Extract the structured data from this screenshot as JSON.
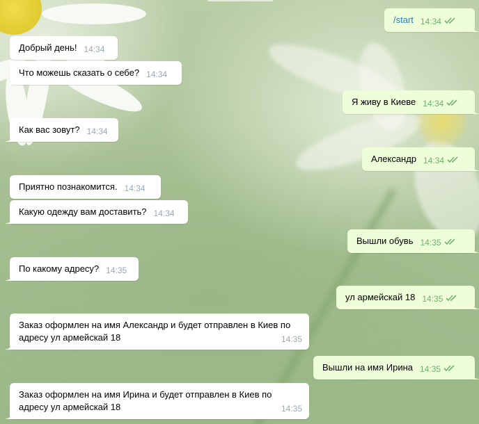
{
  "chat": {
    "messages": [
      {
        "dir": "out",
        "text": "/start",
        "time": "14:34",
        "read": true
      },
      {
        "dir": "in",
        "text": "Добрый день!",
        "time": "14:34"
      },
      {
        "dir": "in",
        "text": "Что можешь сказать о себе?",
        "time": "14:34"
      },
      {
        "dir": "out",
        "text": "Я живу в Киеве",
        "time": "14:34",
        "read": true
      },
      {
        "dir": "in",
        "text": "Как вас зовут?",
        "time": "14:34"
      },
      {
        "dir": "out",
        "text": "Александр",
        "time": "14:34",
        "read": true
      },
      {
        "dir": "in",
        "text": "Приятно познакомится.",
        "time": "14:34"
      },
      {
        "dir": "in",
        "text": "Какую одежду вам доставить?",
        "time": "14:34"
      },
      {
        "dir": "out",
        "text": "Вышли обувь",
        "time": "14:35",
        "read": true
      },
      {
        "dir": "in",
        "text": "По какому адресу?",
        "time": "14:35"
      },
      {
        "dir": "out",
        "text": "ул армейскай 18",
        "time": "14:35",
        "read": true
      },
      {
        "dir": "in",
        "text": "Заказ оформлен на имя Александр и будет отправлен в Киев по адресу ул армейскай 18",
        "time": "14:35"
      },
      {
        "dir": "out",
        "text": "Вышли на имя Ирина",
        "time": "14:35",
        "read": true
      },
      {
        "dir": "in",
        "text": "Заказ оформлен на имя Ирина и будет отправлен в Киев по адресу ул армейскай 18",
        "time": "14:35"
      }
    ]
  },
  "theme": {
    "incoming_bg": "#ffffff",
    "outgoing_bg": "#eefed9",
    "time_in": "#9aa8b2",
    "time_out": "#6fb26b",
    "link": "#2b7bbf"
  },
  "icons": {
    "read_receipt": "double-check-icon"
  }
}
